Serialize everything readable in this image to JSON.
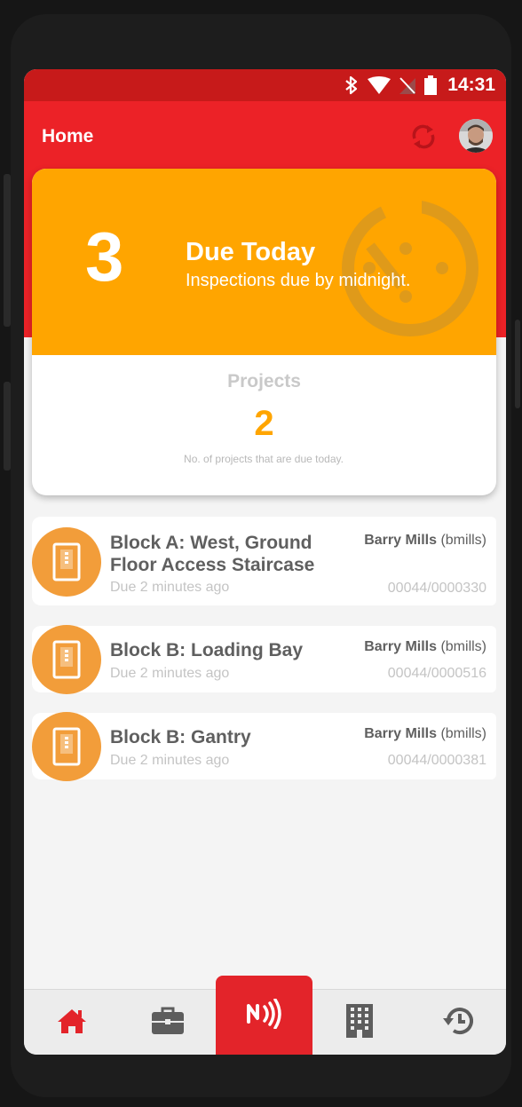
{
  "status_bar": {
    "time": "14:31",
    "icons": [
      "bluetooth-icon",
      "wifi-icon",
      "no-sim-icon",
      "battery-icon"
    ]
  },
  "app_bar": {
    "title": "Home",
    "actions": [
      "sync-icon",
      "avatar"
    ]
  },
  "summary": {
    "due_count": "3",
    "due_title": "Due Today",
    "due_subtitle": "Inspections due by midnight.",
    "projects_label": "Projects",
    "projects_count": "2",
    "projects_desc": "No. of projects that are due today."
  },
  "inspections": [
    {
      "title": "Block A: West, Ground Floor Access Staircase",
      "due": "Due 2 minutes ago",
      "user_name": "Barry Mills",
      "user_id": "(bmills)",
      "ref": "00044/0000330"
    },
    {
      "title": "Block B: Loading Bay",
      "due": "Due 2 minutes ago",
      "user_name": "Barry Mills",
      "user_id": "(bmills)",
      "ref": "00044/0000516"
    },
    {
      "title": "Block B: Gantry",
      "due": "Due 2 minutes ago",
      "user_name": "Barry Mills",
      "user_id": "(bmills)",
      "ref": "00044/0000381"
    }
  ],
  "bottom_nav": [
    "home-icon",
    "briefcase-icon",
    "nfc-icon",
    "building-icon",
    "history-icon"
  ],
  "colors": {
    "primary_red": "#ec2227",
    "status_red": "#c71a1a",
    "orange": "#ffa500",
    "item_orange": "#f29d3a",
    "text_dark": "#5f5f5f",
    "text_light": "#c4c4c4"
  }
}
